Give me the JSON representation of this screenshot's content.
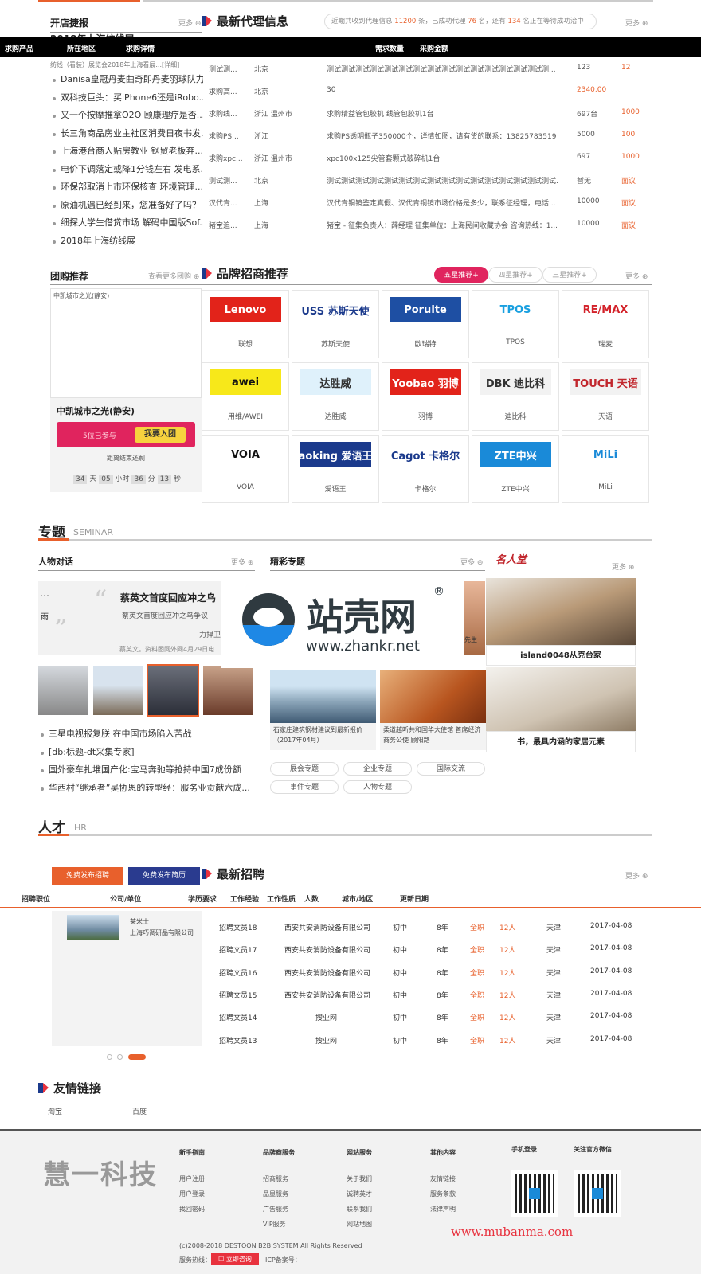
{
  "store_news": {
    "title": "开店捷报",
    "more": "更多",
    "headline": "2018年上海纺线展",
    "sub": "纺线（看装）展览会2018年上海看展...[详细]",
    "items": [
      "Danisa皇冠丹麦曲奇即丹麦羽球队力...",
      "双科技巨头：买iPhone6还是iRobo...",
      "又一个按摩推拿O2O 颐康理疗是否...",
      "长三角商品房业主社区消费日夜书发...",
      "上海港台商人贴房教业 钢贸老板弃...",
      "电价下调落定或降1分钱左右 发电系...",
      "环保部取消上市环保核查 环境管理...",
      "原油机遇已经到来，您准备好了吗？",
      "细探大学生借贷市场 解码中国版Sof...",
      "2018年上海纺线展"
    ]
  },
  "agency": {
    "title": "最新代理信息",
    "stats_pre": "近期共收到代理信息",
    "stats_total": "11200",
    "stats_mid": "条，已成功代理",
    "stats_success": "76",
    "stats_mid2": "名，还有",
    "stats_waiting": "134",
    "stats_post": "名正在等待成功洽中",
    "more": "更多",
    "headers": [
      "求购产品",
      "所在地区",
      "求购详情",
      "需求数量",
      "采购金额"
    ],
    "rows": [
      {
        "product": "测试测...",
        "area": "北京",
        "detail": "测试测试测试测试测试测试测试测试测试测试测试测试测试测试测试测...",
        "qty": "123",
        "amount": "12"
      },
      {
        "product": "求购高...",
        "area": "北京",
        "detail": "30",
        "qty": "2340.00",
        "amount": ""
      },
      {
        "product": "求购线...",
        "area": "浙江 温州市",
        "detail": "求购精益管包胶机 线管包胶机1台",
        "qty": "697台",
        "amount": "1000"
      },
      {
        "product": "求购PS...",
        "area": "浙江",
        "detail": "求购PS透明瓶子350000个，详情如图，请有货的联系：13825783519",
        "qty": "5000",
        "amount": "100"
      },
      {
        "product": "求购xpc...",
        "area": "浙江 温州市",
        "detail": "xpc100x125尖管套颗式破碎机1台",
        "qty": "697",
        "amount": "1000"
      },
      {
        "product": "测试测...",
        "area": "北京",
        "detail": "测试测试测试测试测试测试测试测试测试测试测试测试测试测试测试测试...",
        "qty": "暂无",
        "amount": "面议"
      },
      {
        "product": "汉代青...",
        "area": "上海",
        "detail": "汉代青铜镜鉴定真假、汉代青铜镜市场价格是多少，联系征经理，电话...",
        "qty": "10000",
        "amount": "面议"
      },
      {
        "product": "猪宝追...",
        "area": "上海",
        "detail": "猪宝 - 征集负责人：薛经理 征集单位：上海民间收藏协会 咨询热线：1...",
        "qty": "10000",
        "amount": "面议"
      }
    ]
  },
  "group_buy": {
    "title": "团购推荐",
    "more": "查看更多团购",
    "img_alt": "中凯城市之光(静安)",
    "name": "中凯城市之光(静安)",
    "joined": "5位已参与",
    "join_btn": "我要入团",
    "countdown_label": "距离结束还剩",
    "days": "34",
    "days_unit": "天",
    "hours": "05",
    "hours_unit": "小时",
    "minutes": "36",
    "minutes_unit": "分",
    "seconds": "13",
    "seconds_unit": "秒"
  },
  "brands": {
    "title": "品牌招商推荐",
    "tabs": [
      "五星推荐+",
      "四星推荐+",
      "三星推荐+"
    ],
    "more": "更多",
    "items": [
      {
        "logo": "Lenovo",
        "name": "联想",
        "bg": "#e2231a",
        "fg": "#ffffff"
      },
      {
        "logo": "USS 苏斯天使",
        "name": "苏斯天使",
        "bg": "#ffffff",
        "fg": "#1b3a8c"
      },
      {
        "logo": "Porulte",
        "name": "欧瑞特",
        "bg": "#1e4fa3",
        "fg": "#ffffff"
      },
      {
        "logo": "TPOS",
        "name": "TPOS",
        "bg": "#ffffff",
        "fg": "#1aa0e0"
      },
      {
        "logo": "RE/MAX",
        "name": "瑞麦",
        "bg": "#ffffff",
        "fg": "#d3222a"
      },
      {
        "logo": "awei",
        "name": "用维/AWEI",
        "bg": "#f7e81a",
        "fg": "#111111"
      },
      {
        "logo": "达胜威",
        "name": "达胜威",
        "bg": "#dff1fb",
        "fg": "#333333"
      },
      {
        "logo": "Yoobao 羽博",
        "name": "羽博",
        "bg": "#e2231a",
        "fg": "#ffffff"
      },
      {
        "logo": "DBK 迪比科",
        "name": "迪比科",
        "bg": "#f2f2f2",
        "fg": "#333333"
      },
      {
        "logo": "TOUCH 天语",
        "name": "天语",
        "bg": "#f2f2f2",
        "fg": "#c1272d"
      },
      {
        "logo": "VOIA",
        "name": "VOIA",
        "bg": "#ffffff",
        "fg": "#111111"
      },
      {
        "logo": "aoking 爱语王",
        "name": "爱语王",
        "bg": "#1b3a8c",
        "fg": "#ffffff"
      },
      {
        "logo": "Cagot 卡格尔",
        "name": "卡格尔",
        "bg": "#ffffff",
        "fg": "#1b3a8c"
      },
      {
        "logo": "ZTE中兴",
        "name": "ZTE中兴",
        "bg": "#1a8ad8",
        "fg": "#ffffff"
      },
      {
        "logo": "MiLi",
        "name": "MiLi",
        "bg": "#ffffff",
        "fg": "#1a8ad8"
      }
    ]
  },
  "seminar": {
    "title": "专题",
    "subtitle": "SEMINAR",
    "dialog_title": "人物对话",
    "dialog_more": "更多",
    "dialog_headline": "蔡英文首度回应冲之鸟",
    "dialog_text": "蔡英文首度回应冲之鸟争议",
    "dialog_quote": "力捍卫”",
    "dialog_source": "蔡英文。资料图网外网4月29日电",
    "dialog_left_text": "雨",
    "dialog_news": [
      "三星电视报复朕 在中国市场陷入苦战",
      "[db:标题-dt采集专家]",
      "国外豪车扎堆国产化:宝马奔驰等抢持中国7成份额",
      "华西村“继承者”吴协恩的转型经：服务业贡献六成..."
    ],
    "feature_title": "精彩专题",
    "feature_more": "更多",
    "feature_cards": [
      "石家庄建筑钢材建议到最新报价（2017年04月）",
      "柔道越听共和国华大使馆 首席经济商务公使 顾阳路"
    ],
    "feature_side": "先生",
    "tags": [
      "展会专题",
      "企业专题",
      "国际交流",
      "事件专题",
      "人物专题"
    ],
    "celebrity_title": "名人堂",
    "celebrity_more": "更多",
    "celebrity_items": [
      "island0048从克台家",
      "书，最具内涵的家居元素"
    ]
  },
  "watermark": {
    "brand": "站壳网",
    "url": "www.zhankr.net",
    "reg": "®"
  },
  "hr": {
    "title": "人才",
    "subtitle": "HR",
    "btn_recruit": "免费发布招聘",
    "btn_resume": "免费发布简历",
    "latest_title": "最新招聘",
    "more": "更多",
    "headers": [
      "招聘职位",
      "公司/单位",
      "学历要求",
      "工作经验",
      "工作性质",
      "人数",
      "城市/地区",
      "更新日期"
    ],
    "featured_company": "莱米士",
    "featured_sub": "上海巧调研品有限公司",
    "rows": [
      {
        "job": "招聘文员18",
        "company": "西安共安消防设备有限公司",
        "edu": "初中",
        "exp": "8年",
        "type": "全职",
        "num": "12人",
        "city": "天津",
        "date": "2017-04-08"
      },
      {
        "job": "招聘文员17",
        "company": "西安共安消防设备有限公司",
        "edu": "初中",
        "exp": "8年",
        "type": "全职",
        "num": "12人",
        "city": "天津",
        "date": "2017-04-08"
      },
      {
        "job": "招聘文员16",
        "company": "西安共安消防设备有限公司",
        "edu": "初中",
        "exp": "8年",
        "type": "全职",
        "num": "12人",
        "city": "天津",
        "date": "2017-04-08"
      },
      {
        "job": "招聘文员15",
        "company": "西安共安消防设备有限公司",
        "edu": "初中",
        "exp": "8年",
        "type": "全职",
        "num": "12人",
        "city": "天津",
        "date": "2017-04-08"
      },
      {
        "job": "招聘文员14",
        "company": "搜业网",
        "edu": "初中",
        "exp": "8年",
        "type": "全职",
        "num": "12人",
        "city": "天津",
        "date": "2017-04-08"
      },
      {
        "job": "招聘文员13",
        "company": "搜业网",
        "edu": "初中",
        "exp": "8年",
        "type": "全职",
        "num": "12人",
        "city": "天津",
        "date": "2017-04-08"
      }
    ]
  },
  "links": {
    "title": "友情链接",
    "items": [
      "淘宝",
      "百度"
    ]
  },
  "footer": {
    "logo": "慧一科技",
    "cols": [
      {
        "title": "新手指南",
        "items": [
          "用户注册",
          "用户登录",
          "找回密码"
        ]
      },
      {
        "title": "品牌商服务",
        "items": [
          "招商服务",
          "品显服务",
          "广告服务",
          "VIP服务"
        ]
      },
      {
        "title": "网站服务",
        "items": [
          "关于我们",
          "诚聘英才",
          "联系我们",
          "网站地图"
        ]
      },
      {
        "title": "其他内容",
        "items": [
          "友情链接",
          "服务条款",
          "法律声明"
        ]
      }
    ],
    "mobile_title": "手机登录",
    "wechat_title": "关注官方微信",
    "copyright": "(c)2008-2018 DESTOON B2B SYSTEM All Rights Reserved",
    "service_label": "服务热线：",
    "consult_btn": "立即咨询",
    "icp": "ICP备案号：",
    "site_watermark": "www.mubanma.com"
  },
  "colors": {
    "accent": "#e8602c",
    "red": "#e8323e",
    "blue": "#1b3a8c",
    "pink": "#e0245e"
  }
}
